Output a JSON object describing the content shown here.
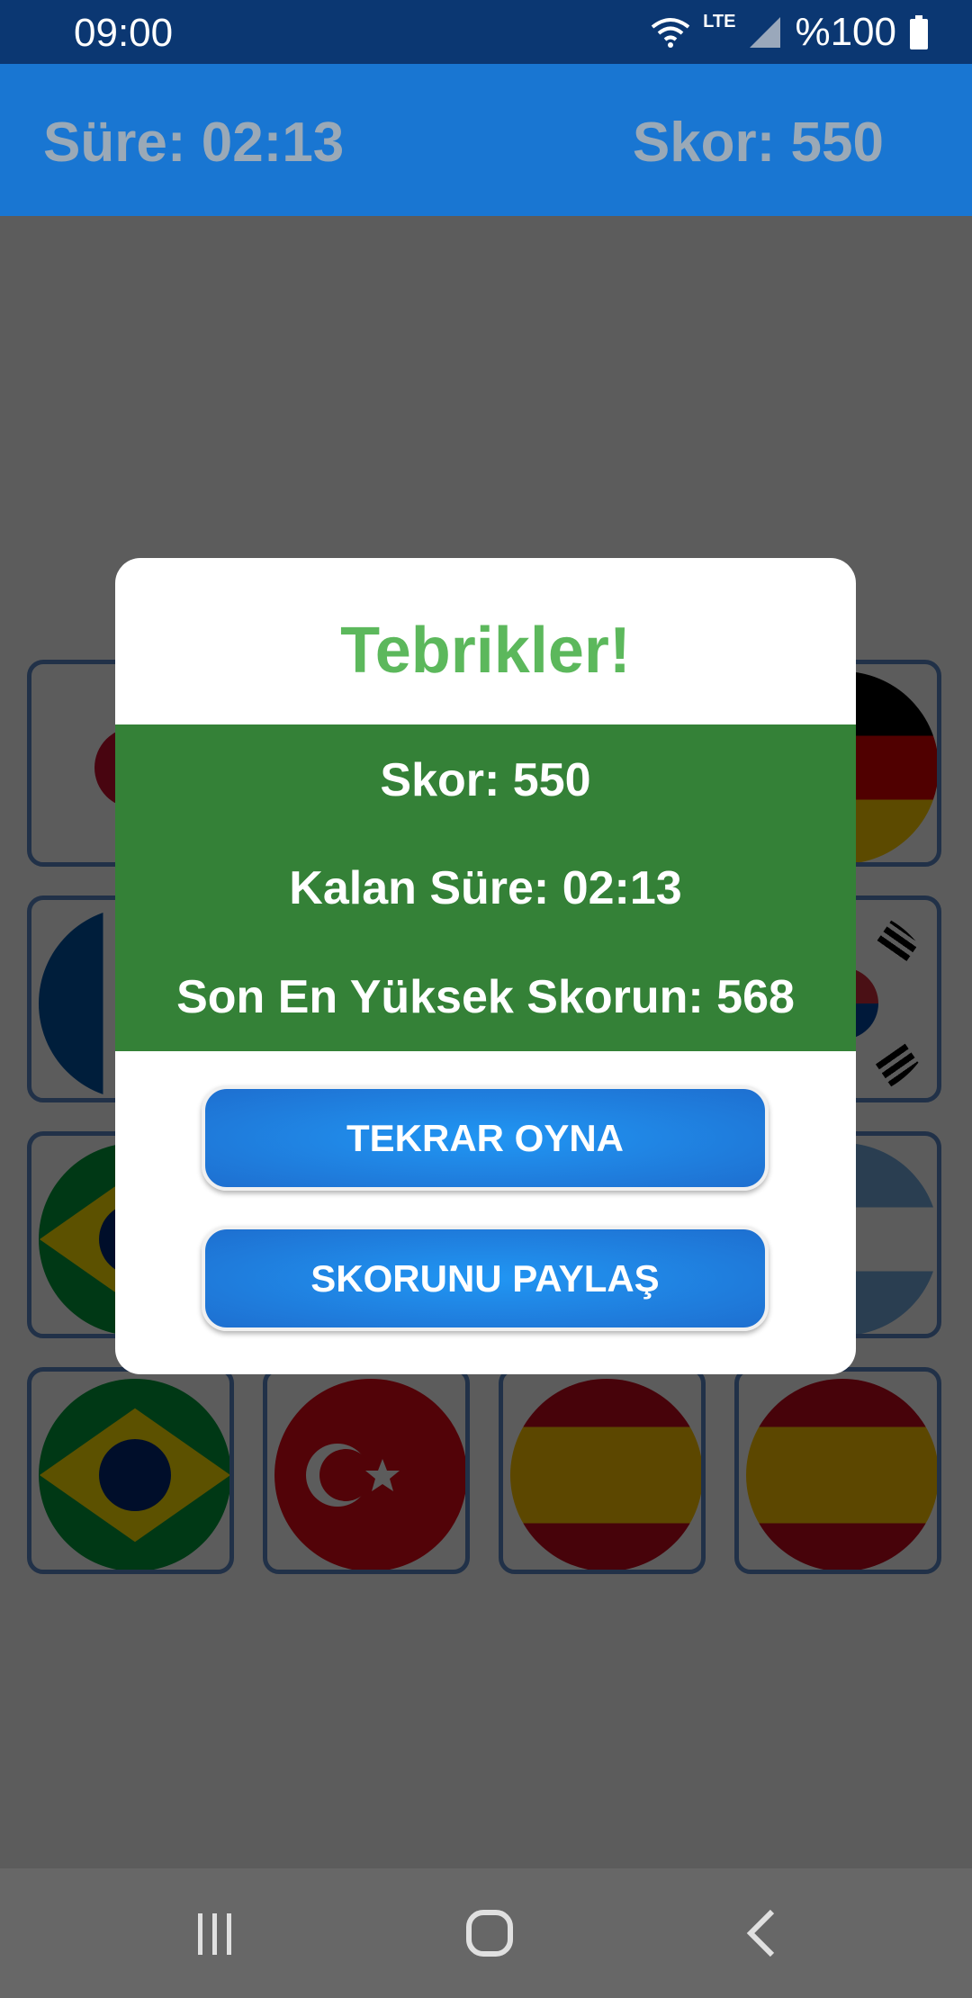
{
  "status_bar": {
    "time": "09:00",
    "network": "LTE",
    "battery": "%100"
  },
  "header": {
    "timer": "Süre: 02:13",
    "score": "Skor: 550"
  },
  "dialog": {
    "title": "Tebrikler!",
    "score": "Skor: 550",
    "remaining_time": "Kalan Süre: 02:13",
    "high_score": "Son En Yüksek Skorun: 568",
    "play_again_label": "TEKRAR OYNA",
    "share_label": "SKORUNU PAYLAŞ"
  },
  "colors": {
    "primary": "#1976d2",
    "success": "#5cb85c",
    "stats_bg": "#348137"
  },
  "nav_bar": {
    "icons": [
      "recent-apps-icon",
      "home-icon",
      "back-icon"
    ]
  }
}
